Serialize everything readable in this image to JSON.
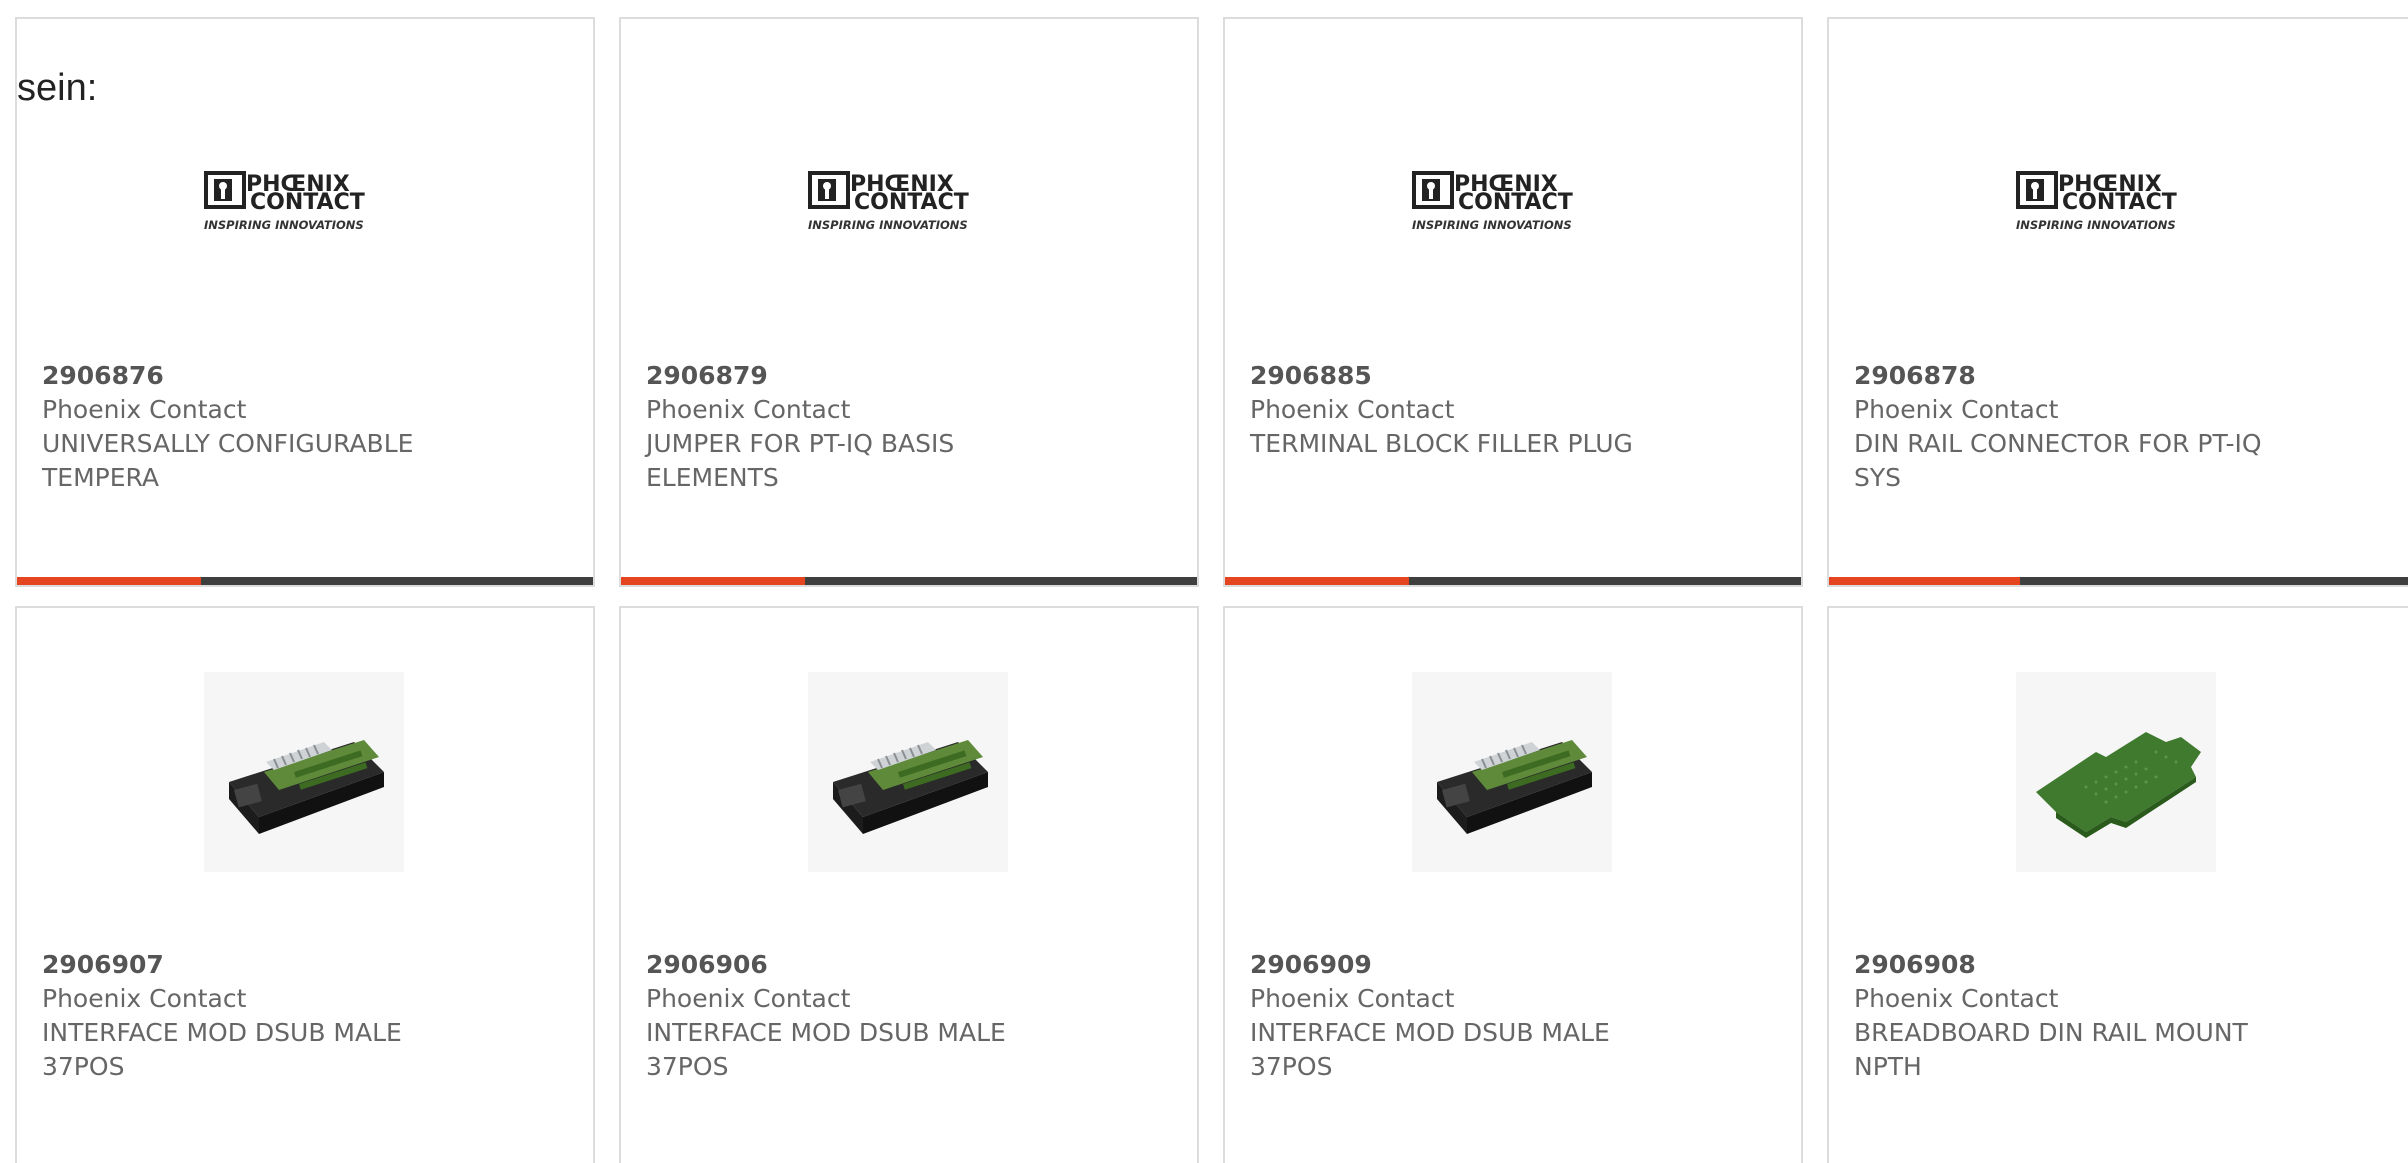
{
  "intro_text": "sein:",
  "colors": {
    "accent": "#e5451e",
    "bar_dark": "#3f3f3f",
    "card_border": "#dcdcdc",
    "text_grey": "#666666"
  },
  "logo": {
    "word1": "PHŒNIX",
    "word2": "CONTACT",
    "tagline": "INSPIRING INNOVATIONS"
  },
  "products": [
    {
      "part_number": "2906876",
      "manufacturer": "Phoenix Contact",
      "description": "UNIVERSALLY CONFIGURABLE TEMPERA",
      "image": "phoenix-contact-logo",
      "hover_progress": 0.32
    },
    {
      "part_number": "2906879",
      "manufacturer": "Phoenix Contact",
      "description": "JUMPER FOR PT-IQ BASIS ELEMENTS",
      "image": "phoenix-contact-logo",
      "hover_progress": 0.32
    },
    {
      "part_number": "2906885",
      "manufacturer": "Phoenix Contact",
      "description": "TERMINAL BLOCK FILLER PLUG",
      "image": "phoenix-contact-logo",
      "hover_progress": 0.32
    },
    {
      "part_number": "2906878",
      "manufacturer": "Phoenix Contact",
      "description": "DIN RAIL CONNECTOR FOR PT-IQ SYS",
      "image": "phoenix-contact-logo",
      "hover_progress": 0.32
    },
    {
      "part_number": "2906907",
      "manufacturer": "Phoenix Contact",
      "description": "INTERFACE MOD DSUB MALE 37POS",
      "image": "interface-module-photo"
    },
    {
      "part_number": "2906906",
      "manufacturer": "Phoenix Contact",
      "description": "INTERFACE MOD DSUB MALE 37POS",
      "image": "interface-module-photo"
    },
    {
      "part_number": "2906909",
      "manufacturer": "Phoenix Contact",
      "description": "INTERFACE MOD DSUB MALE 37POS",
      "image": "interface-module-photo"
    },
    {
      "part_number": "2906908",
      "manufacturer": "Phoenix Contact",
      "description": "BREADBOARD DIN RAIL MOUNT NPTH",
      "image": "breadboard-photo"
    }
  ]
}
